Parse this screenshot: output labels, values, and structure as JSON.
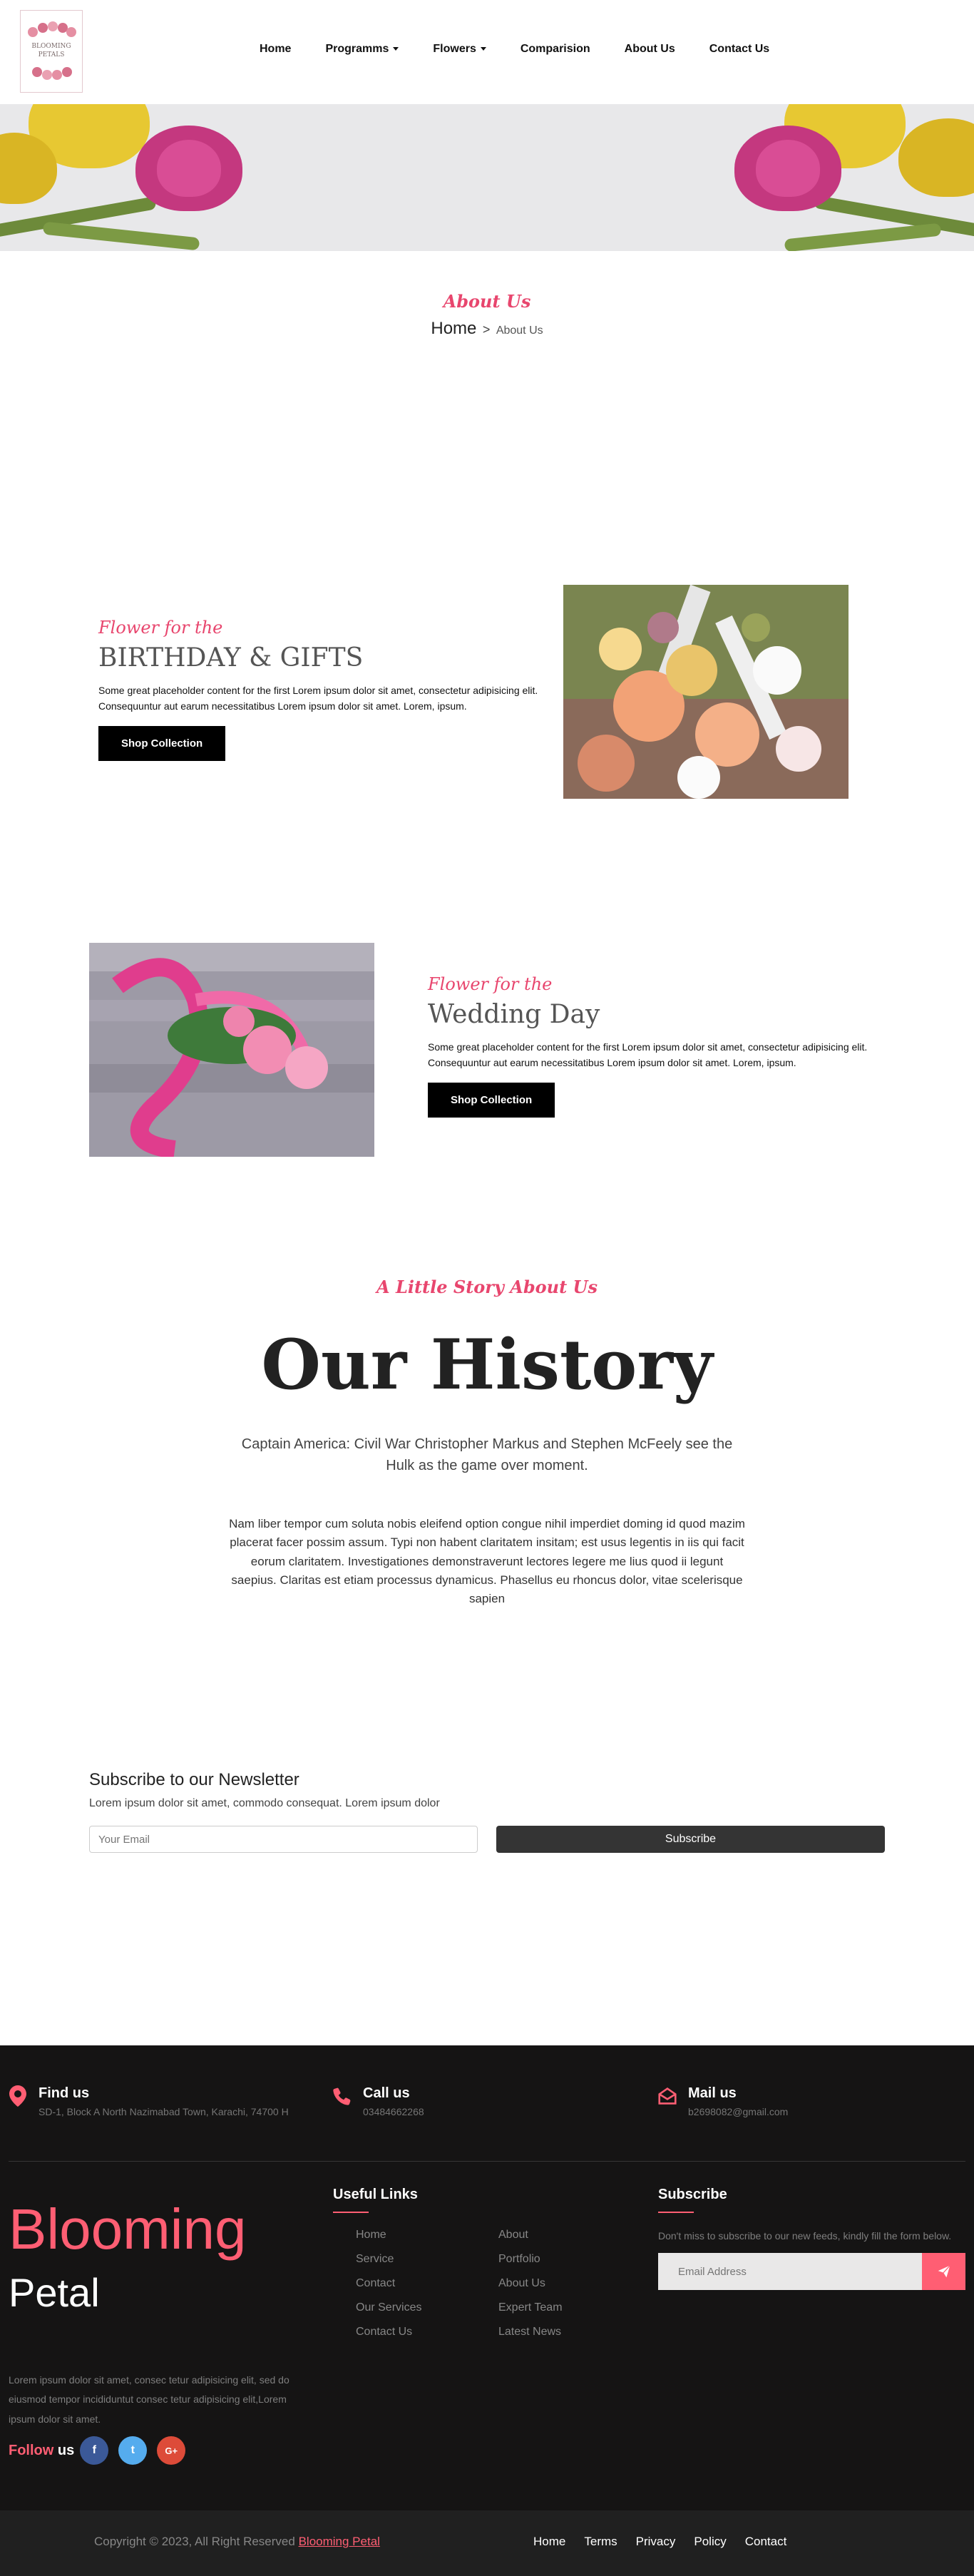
{
  "logo": {
    "text_line1": "BLOOMING",
    "text_line2": "PETALS"
  },
  "nav": {
    "items": [
      {
        "label": "Home"
      },
      {
        "label": "Programms",
        "dropdown": true
      },
      {
        "label": "Flowers",
        "dropdown": true
      },
      {
        "label": "Comparision"
      },
      {
        "label": "About Us"
      },
      {
        "label": "Contact Us"
      }
    ]
  },
  "about_header": {
    "title": "About Us",
    "breadcrumb_home": "Home",
    "breadcrumb_sep": ">",
    "breadcrumb_current": "About Us"
  },
  "feature1": {
    "subtitle": "Flower for the",
    "title": "BIRTHDAY & GIFTS",
    "body": "Some great placeholder content for the first Lorem ipsum dolor sit amet, consectetur adipisicing elit. Consequuntur aut earum necessitatibus Lorem ipsum dolor sit amet. Lorem, ipsum.",
    "button": "Shop Collection"
  },
  "feature2": {
    "subtitle": "Flower for the",
    "title": "Wedding Day",
    "body": "Some great placeholder content for the first Lorem ipsum dolor sit amet, consectetur adipisicing elit. Consequuntur aut earum necessitatibus Lorem ipsum dolor sit amet. Lorem, ipsum.",
    "button": "Shop Collection"
  },
  "history": {
    "subtitle": "A Little Story About Us",
    "title": "Our History",
    "lead": "Captain America: Civil War Christopher Markus and Stephen McFeely see the Hulk as the game over moment.",
    "body": "Nam liber tempor cum soluta nobis eleifend option congue nihil imperdiet doming id quod mazim placerat facer possim assum. Typi non habent claritatem insitam; est usus legentis in iis qui facit eorum claritatem. Investigationes demonstraverunt lectores legere me lius quod ii legunt saepius. Claritas est etiam processus dynamicus. Phasellus eu rhoncus dolor, vitae scelerisque sapien"
  },
  "newsletter": {
    "title": "Subscribe to our Newsletter",
    "subtitle": "Lorem ipsum dolor sit amet, commodo consequat. Lorem ipsum dolor",
    "placeholder": "Your Email",
    "button": "Subscribe"
  },
  "footer": {
    "contacts": [
      {
        "title": "Find us",
        "text": "SD-1, Block A North Nazimabad Town, Karachi, 74700 H",
        "icon": "map-marker-icon"
      },
      {
        "title": "Call us",
        "text": "03484662268",
        "icon": "phone-icon"
      },
      {
        "title": "Mail us",
        "text": "b2698082@gmail.com",
        "icon": "envelope-open-icon"
      }
    ],
    "brand_line1": "Blooming",
    "brand_line2": "Petal",
    "description": "Lorem ipsum dolor sit amet, consec tetur adipisicing elit, sed do eiusmod tempor incididuntut consec tetur adipisicing elit,Lorem ipsum dolor sit amet.",
    "follow_label": "Follow",
    "follow_label2": "us",
    "social": [
      {
        "label": "f",
        "color": "#3b5998",
        "icon": "facebook-icon"
      },
      {
        "label": "t",
        "color": "#55acee",
        "icon": "twitter-icon"
      },
      {
        "label": "G+",
        "color": "#dd4b39",
        "icon": "google-plus-icon"
      }
    ],
    "useful_links_title": "Useful Links",
    "useful_links": [
      "Home",
      "About",
      "Service",
      "Portfolio",
      "Contact",
      "About Us",
      "Our Services",
      "Expert Team",
      "Contact Us",
      "Latest News"
    ],
    "subscribe_title": "Subscribe",
    "subscribe_text": "Don't miss to subscribe to our new feeds, kindly fill the form below.",
    "subscribe_placeholder": "Email Address",
    "copyright_text": "Copyright © 2023, All Right Reserved",
    "copyright_link": "Blooming Petal",
    "bottom_links": [
      "Home",
      "Terms",
      "Privacy",
      "Policy",
      "Contact"
    ]
  },
  "colors": {
    "accent": "#ff5e73",
    "script_pink": "#e8466e",
    "footer_bg": "#151414",
    "copyright_bg": "#202020"
  }
}
